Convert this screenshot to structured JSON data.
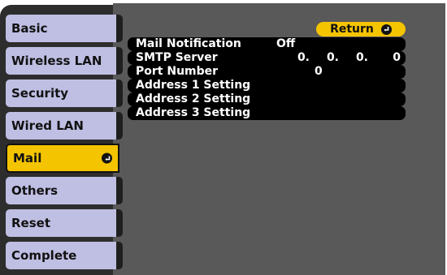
{
  "sidebar": {
    "items": [
      {
        "label": "Basic"
      },
      {
        "label": "Wireless LAN"
      },
      {
        "label": "Security"
      },
      {
        "label": "Wired LAN"
      },
      {
        "label": "Mail",
        "active": true
      },
      {
        "label": "Others"
      },
      {
        "label": "Reset"
      },
      {
        "label": "Complete"
      }
    ]
  },
  "header": {
    "return_label": "Return"
  },
  "settings": {
    "mail_notification": {
      "label": "Mail Notification",
      "value": "Off"
    },
    "smtp_server": {
      "label": "SMTP Server",
      "octets": [
        "0.",
        "0.",
        "0.",
        "0"
      ]
    },
    "port_number": {
      "label": "Port Number",
      "value": "0"
    },
    "address_1": {
      "label": "Address 1 Setting"
    },
    "address_2": {
      "label": "Address 2 Setting"
    },
    "address_3": {
      "label": "Address 3 Setting"
    }
  },
  "colors": {
    "highlight": "#f5c400",
    "menu_item": "#bfbfe4",
    "panel": "#595959",
    "frame": "#2d2d2d"
  },
  "icons": {
    "enter": "enter-icon"
  }
}
